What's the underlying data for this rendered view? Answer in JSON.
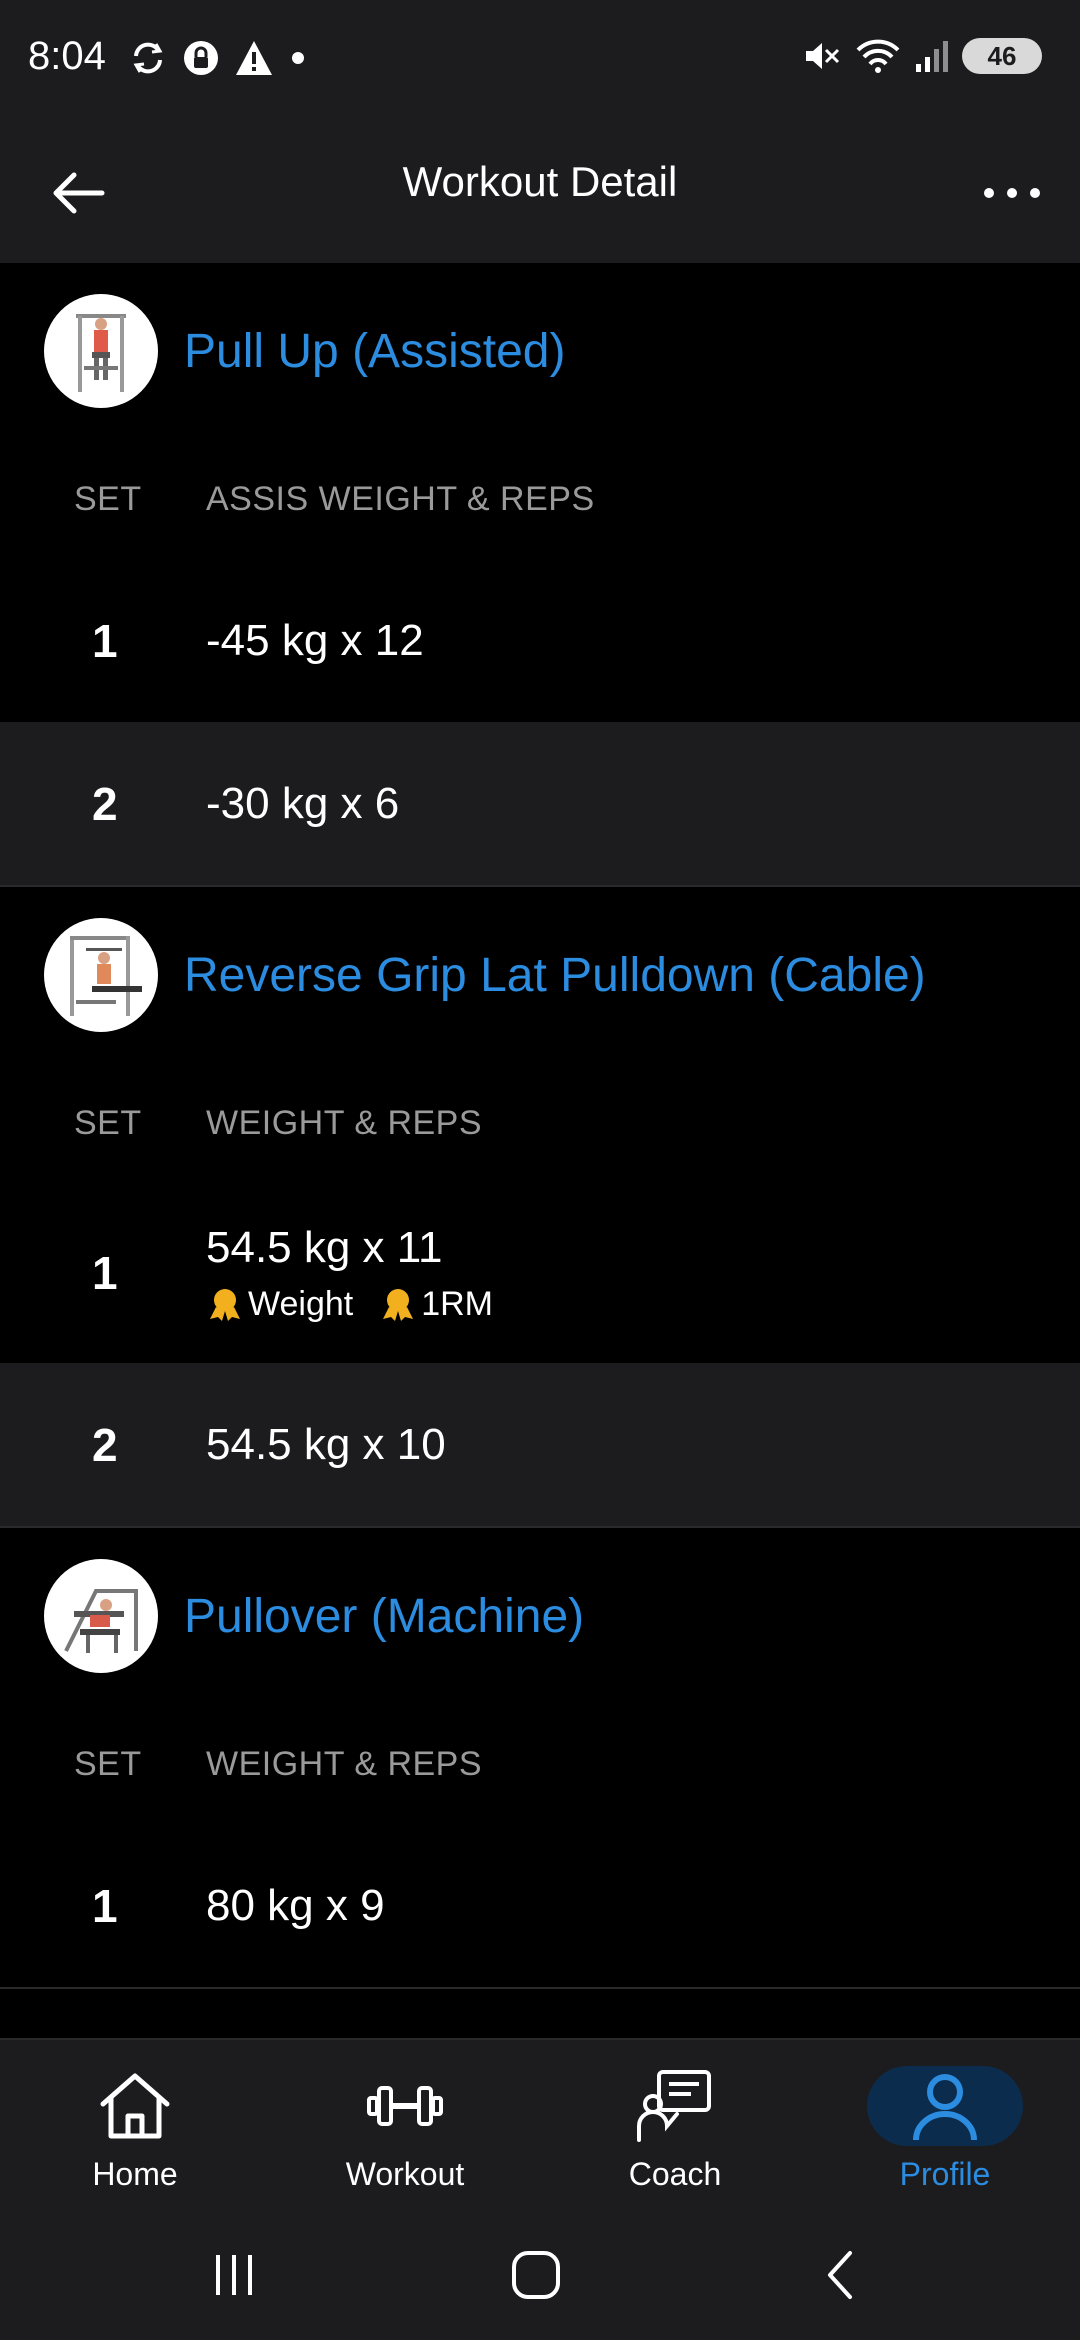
{
  "status_bar": {
    "time": "8:04",
    "battery": "46"
  },
  "app_bar": {
    "title": "Workout Detail"
  },
  "exercises": [
    {
      "name": "Pull Up (Assisted)",
      "set_col": "SET",
      "value_col": "ASSIS WEIGHT & REPS",
      "sets": [
        {
          "num": "1",
          "value": "-45 kg x 12"
        },
        {
          "num": "2",
          "value": "-30 kg x 6"
        }
      ]
    },
    {
      "name": "Reverse Grip Lat Pulldown (Cable)",
      "set_col": "SET",
      "value_col": "WEIGHT & REPS",
      "sets": [
        {
          "num": "1",
          "value": "54.5 kg x 11",
          "badges": [
            "Weight",
            "1RM"
          ]
        },
        {
          "num": "2",
          "value": "54.5 kg x 10"
        }
      ]
    },
    {
      "name": "Pullover (Machine)",
      "set_col": "SET",
      "value_col": "WEIGHT & REPS",
      "sets": [
        {
          "num": "1",
          "value": "80 kg x 9"
        }
      ]
    }
  ],
  "bottom_nav": {
    "home": "Home",
    "workout": "Workout",
    "coach": "Coach",
    "profile": "Profile",
    "active": "Profile"
  },
  "colors": {
    "accent": "#2b8ce0",
    "bar_bg": "#1c1c1e",
    "badge": "#f2b01e"
  }
}
